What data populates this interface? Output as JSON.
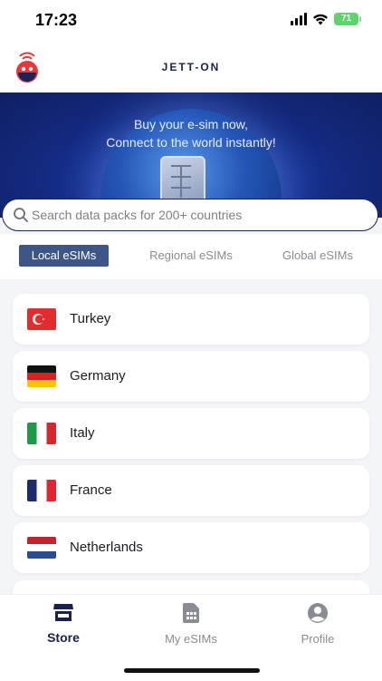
{
  "status_bar": {
    "time": "17:23",
    "battery": "71"
  },
  "header": {
    "brand": "JETT-ON"
  },
  "banner": {
    "line1": "Buy your e-sim now,",
    "line2": "Connect to the world instantly!"
  },
  "search": {
    "placeholder": "Search data packs for 200+ countries",
    "value": ""
  },
  "tabs": [
    {
      "label": "Local eSIMs",
      "active": true
    },
    {
      "label": "Regional eSIMs",
      "active": false
    },
    {
      "label": "Global eSIMs",
      "active": false
    }
  ],
  "countries": [
    {
      "name": "Turkey",
      "flag": "turkey-flag-icon"
    },
    {
      "name": "Germany",
      "flag": "germany-flag-icon"
    },
    {
      "name": "Italy",
      "flag": "italy-flag-icon"
    },
    {
      "name": "France",
      "flag": "france-flag-icon"
    },
    {
      "name": "Netherlands",
      "flag": "netherlands-flag-icon"
    }
  ],
  "nav": [
    {
      "label": "Store",
      "icon": "store-icon",
      "active": true
    },
    {
      "label": "My eSIMs",
      "icon": "sim-card-icon",
      "active": false
    },
    {
      "label": "Profile",
      "icon": "profile-icon",
      "active": false
    }
  ],
  "colors": {
    "brand_navy": "#1a2050",
    "tab_active": "#3e5687",
    "battery": "#5cd66a"
  }
}
